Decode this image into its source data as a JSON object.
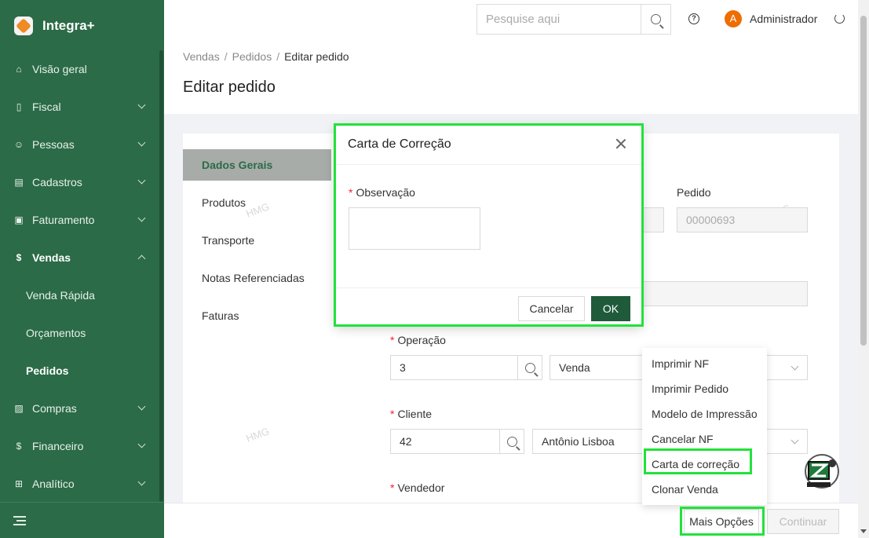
{
  "app": {
    "name": "Integra+"
  },
  "sidebar": {
    "items": [
      {
        "label": "Visão geral",
        "icon": "home-icon"
      },
      {
        "label": "Fiscal",
        "icon": "document-icon"
      },
      {
        "label": "Pessoas",
        "icon": "people-icon"
      },
      {
        "label": "Cadastros",
        "icon": "register-icon"
      },
      {
        "label": "Faturamento",
        "icon": "billing-icon"
      },
      {
        "label": "Vendas",
        "icon": "dollar-icon"
      },
      {
        "label": "Venda Rápida"
      },
      {
        "label": "Orçamentos"
      },
      {
        "label": "Pedidos"
      },
      {
        "label": "Compras",
        "icon": "chart-icon"
      },
      {
        "label": "Financeiro",
        "icon": "finance-icon"
      },
      {
        "label": "Analítico",
        "icon": "analytics-icon"
      }
    ]
  },
  "header": {
    "search_placeholder": "Pesquise aqui",
    "user_initial": "A",
    "user_name": "Administrador"
  },
  "breadcrumb": {
    "items": [
      "Vendas",
      "Pedidos",
      "Editar pedido"
    ],
    "separator": "/"
  },
  "page": {
    "title": "Editar pedido"
  },
  "tabs": [
    "Dados Gerais",
    "Produtos",
    "Transporte",
    "Notas Referenciadas",
    "Faturas"
  ],
  "watermark": "HMG",
  "form": {
    "pedido_label": "Pedido",
    "pedido_value": "00000693",
    "operacao_label": "Operação",
    "operacao_code": "3",
    "operacao_desc": "Venda",
    "cliente_label": "Cliente",
    "cliente_code": "42",
    "cliente_name": "Antônio Lisboa",
    "vendedor_label": "Vendedor",
    "required_mark": "*"
  },
  "modal": {
    "title": "Carta de Correção",
    "field_label": "Observação",
    "cancel": "Cancelar",
    "ok": "OK"
  },
  "dropdown": {
    "items": [
      "Imprimir NF",
      "Imprimir Pedido",
      "Modelo de Impressão",
      "Cancelar NF",
      "Carta de correção",
      "Clonar Venda"
    ]
  },
  "footer": {
    "more_options": "Mais Opções",
    "continue": "Continuar"
  },
  "colors": {
    "sidebar": "#2b6b47",
    "primary": "#1f5a3b",
    "highlight": "#22e23a",
    "avatar": "#ef6c00"
  }
}
